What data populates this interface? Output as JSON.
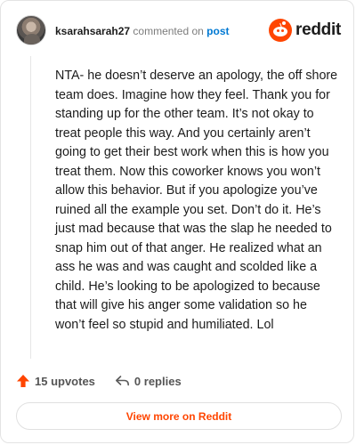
{
  "header": {
    "username": "ksarahsarah27",
    "commented_text": "commented on",
    "post_link": "post",
    "logo_text": "reddit"
  },
  "comment": {
    "body": "NTA- he doesn’t deserve an apology, the off shore team does. Imagine how they feel. Thank you for standing up for the other team. It’s not okay to treat people this way. And you certainly aren’t going to get their best work when this is how you treat them. Now this coworker knows you won’t allow this behavior. But if you apologize you’ve ruined all the example you set. Don’t do it. He’s just mad because that was the slap he needed to snap him out of that anger. He realized what an ass he was and was caught and scolded like a child. He’s looking to be apologized to because that will give his anger some validation so he won’t feel so stupid and humiliated. Lol"
  },
  "actions": {
    "upvotes": "15 upvotes",
    "replies": "0 replies"
  },
  "footer": {
    "view_more": "View more on Reddit"
  },
  "colors": {
    "accent": "#ff4500",
    "link": "#0079d3",
    "text": "#1c1c1c",
    "muted": "#7c7c7c"
  },
  "icons": {
    "upvote": "upvote-arrow-icon",
    "reply": "reply-arrow-icon",
    "logo": "reddit-snoo-icon"
  }
}
